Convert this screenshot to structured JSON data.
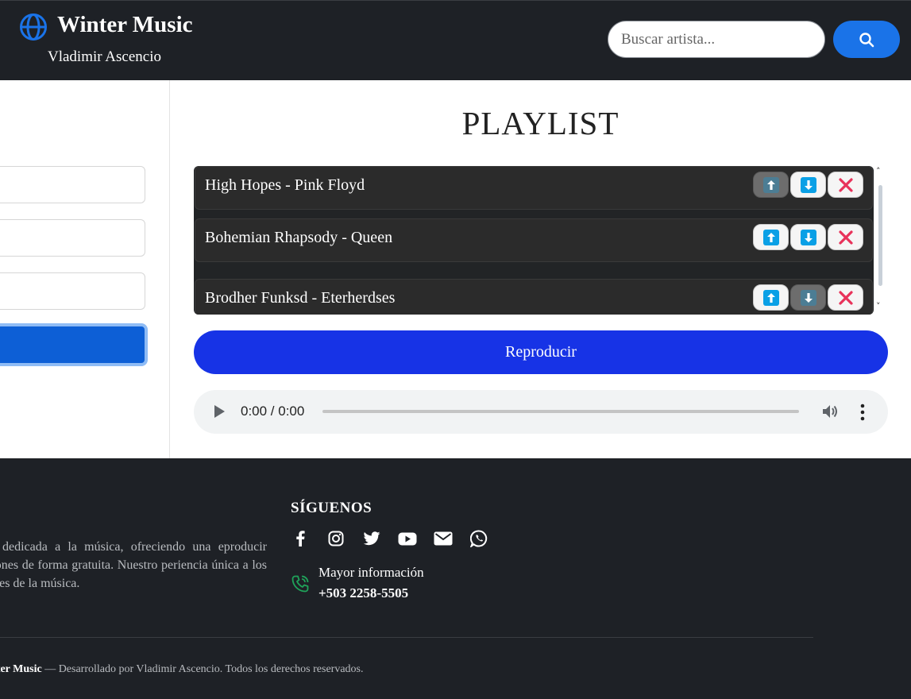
{
  "header": {
    "brand_title": "Winter Music",
    "brand_subtitle": "Vladimir Ascencio",
    "search_placeholder": "Buscar artista...",
    "brand_icon": "globe-icon",
    "search_icon": "search-icon"
  },
  "playlist": {
    "title": "PLAYLIST",
    "tracks": [
      {
        "name": "High Hopes - Pink Floyd",
        "up_enabled": false,
        "down_enabled": true
      },
      {
        "name": "Bohemian Rhapsody - Queen",
        "up_enabled": true,
        "down_enabled": true
      },
      {
        "name": "Brodher Funksd - Eterherdses",
        "up_enabled": true,
        "down_enabled": false
      }
    ],
    "play_label": "Reproducir"
  },
  "audio": {
    "time": "0:00 / 0:00"
  },
  "footer": {
    "about_text": "presa dedicada a la música, ofreciendo una eproducir canciones de forma gratuita. Nuestro periencia única a los amantes de la música.",
    "follow_title": "SÍGUENOS",
    "social": [
      "facebook-icon",
      "instagram-icon",
      "twitter-icon",
      "youtube-icon",
      "email-icon",
      "whatsapp-icon"
    ],
    "info_label": "Mayor información",
    "phone": "+503 2258-5505",
    "copyright_brand": "nter Music",
    "copyright_text": " — Desarrollado por Vladimir Ascencio. Todos los derechos reservados."
  },
  "colors": {
    "dark_bg": "#1e2126",
    "accent_blue": "#1a73e8",
    "play_blue": "#1733e6",
    "arrow_blue": "#0aa0e6",
    "remove_red": "#e8325a",
    "phone_green": "#1fa35a"
  }
}
